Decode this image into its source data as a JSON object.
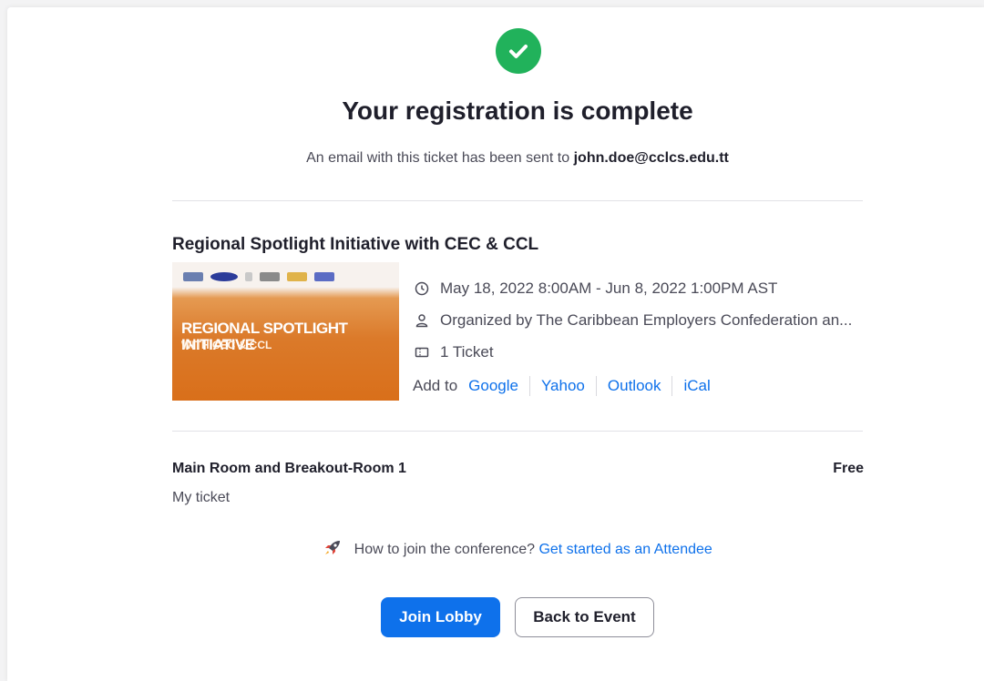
{
  "colors": {
    "accent": "#0e71eb",
    "success": "#21b25b",
    "text": "#1f1f2b",
    "muted": "#4a4a57"
  },
  "header": {
    "success_icon": "check-circle-icon",
    "title": "Your registration is complete",
    "email_prefix": "An email with this ticket has been sent to",
    "email": "john.doe@cclcs.edu.tt"
  },
  "event": {
    "title": "Regional Spotlight Initiative with CEC & CCL",
    "banner_title": "REGIONAL SPOTLIGHT INITIATIVE",
    "banner_subtitle": "WITH CEC & CCL",
    "datetime": "May 18, 2022 8:00AM - Jun 8, 2022 1:00PM AST",
    "organizer": "Organized by The Caribbean Employers Confederation an...",
    "tickets": "1 Ticket",
    "add_to_label": "Add to",
    "calendars": [
      "Google",
      "Yahoo",
      "Outlook",
      "iCal"
    ]
  },
  "ticket": {
    "name": "Main Room and Breakout-Room 1",
    "price": "Free",
    "note": "My ticket"
  },
  "help": {
    "question": "How to join the conference?",
    "link": "Get started as an Attendee"
  },
  "actions": {
    "join_label": "Join Lobby",
    "back_label": "Back to Event"
  }
}
